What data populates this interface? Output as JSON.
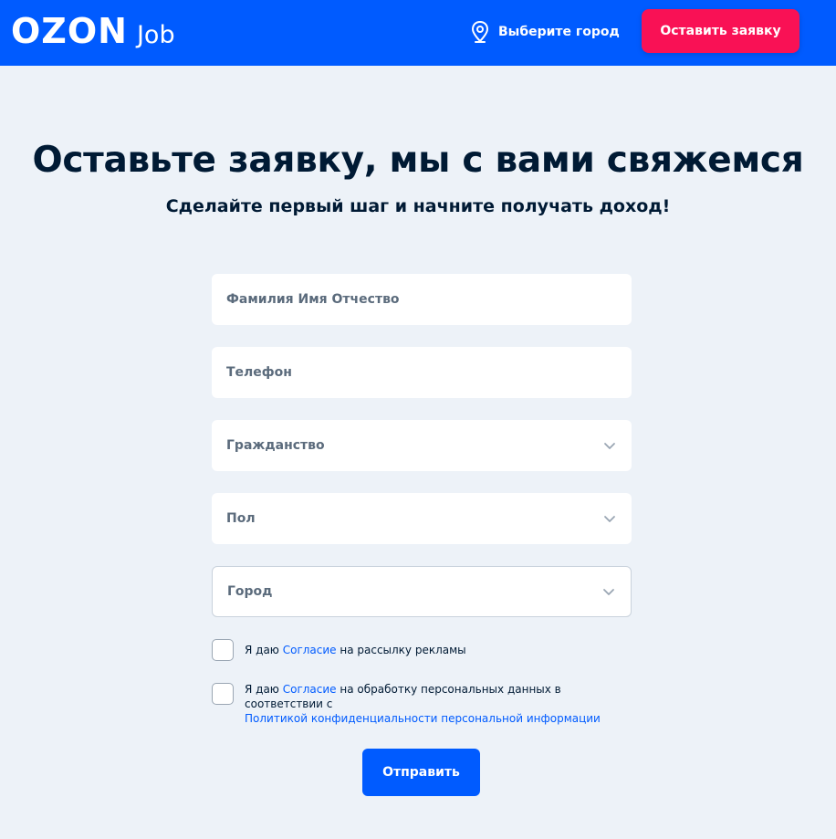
{
  "header": {
    "logo_main": "OZON",
    "logo_sub": "Job",
    "city_label": "Выберите город",
    "city_icon": "location-pin-icon",
    "apply_label": "Оставить заявку"
  },
  "colors": {
    "brand_blue": "#005bff",
    "accent_pink": "#f91155",
    "page_bg": "#edf2f8",
    "text_dark": "#001a34"
  },
  "main": {
    "title": "Оставьте заявку, мы с вами свяжемся",
    "subtitle": "Сделайте первый шаг и начните получать доход!"
  },
  "form": {
    "full_name": {
      "placeholder": "Фамилия Имя Отчество",
      "value": ""
    },
    "phone": {
      "placeholder": "Телефон",
      "value": ""
    },
    "citizenship": {
      "placeholder": "Гражданство",
      "icon": "chevron-down-icon"
    },
    "gender": {
      "placeholder": "Пол",
      "icon": "chevron-down-icon"
    },
    "city": {
      "placeholder": "Город",
      "icon": "chevron-down-icon"
    },
    "consent_ads": {
      "prefix": "Я даю ",
      "link": "Согласие",
      "suffix": " на рассылку рекламы"
    },
    "consent_personal": {
      "prefix": "Я даю ",
      "link": "Согласие",
      "suffix": " на обработку персональных данных в соответствии с",
      "policy_link": "Политикой конфиденциальности персональной информации"
    },
    "submit_label": "Отправить"
  }
}
